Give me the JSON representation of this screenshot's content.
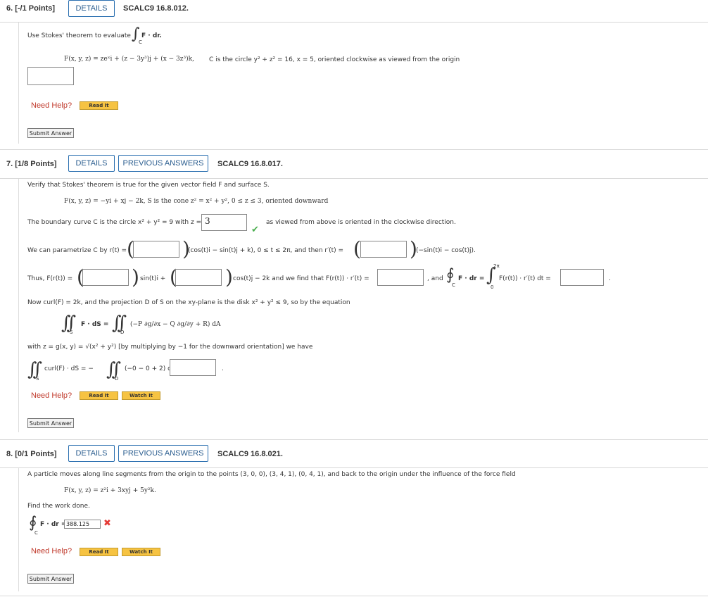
{
  "q6": {
    "number": "6. [-/1 Points]",
    "details": "DETAILS",
    "code": "SCALC9 16.8.012.",
    "intro": "Use Stokes' theorem to evaluate",
    "integrand": "F · dr.",
    "sub": "C",
    "field": "F(x, y, z) = zeˣi + (z − 3y³)j + (x − 3z³)k,",
    "curve": "C is the circle y² + z² = 16, x = 5, oriented clockwise as viewed from the origin",
    "need_help": "Need Help?",
    "read_it": "Read It",
    "submit": "Submit Answer"
  },
  "q7": {
    "number": "7. [1/8 Points]",
    "details": "DETAILS",
    "previous": "PREVIOUS ANSWERS",
    "code": "SCALC9 16.8.017.",
    "intro": "Verify that Stokes' theorem is true for the given vector field F and surface S.",
    "field": "F(x, y, z) = −yi + xj − 2k,   S is the cone z² = x² + y², 0 ≤ z ≤ 3, oriented downward",
    "boundary_pre": "The boundary curve C is the circle x² + y² = 9 with z =",
    "boundary_val": "3",
    "boundary_post": "as viewed from above is oriented in the clockwise direction.",
    "param_pre": "We can parametrize C by r(t) =",
    "param_mid": "(cos(t)i − sin(t)j + k), 0 ≤ t ≤ 2π, and then r′(t) =",
    "param_post": "(−sin(t)i − cos(t)j).",
    "thus_pre": "Thus, F(r(t)) =",
    "thus_mid1": "sin(t)i +",
    "thus_mid2": "cos(t)j − 2k and we find that F(r(t)) · r′(t) =",
    "thus_and": ", and",
    "thus_int": "F · dr =",
    "thus_int2": "F(r(t)) · r′(t) dt =",
    "upper": "2π",
    "lower": "0",
    "sub_c": "C",
    "curl_text": "Now curl(F) = 2k, and the projection D of S on the xy-plane is the disk x² + y² ≤ 9, so by the equation",
    "surf_int": "F · dS =",
    "surf_rhs": "(−P ∂g/∂x − Q ∂g/∂y + R) dA",
    "sub_s": "S",
    "sub_d": "D",
    "with_text": "with z = g(x, y) = √(x² + y²)  [by multiplying by −1 for the downward orientation] we have",
    "final_lhs": "curl(F) · dS = −",
    "final_rhs": "(−0 − 0 + 2) dA =",
    "period": ".",
    "need_help": "Need Help?",
    "read_it": "Read It",
    "watch_it": "Watch It",
    "submit": "Submit Answer"
  },
  "q8": {
    "number": "8. [0/1 Points]",
    "details": "DETAILS",
    "previous": "PREVIOUS ANSWERS",
    "code": "SCALC9 16.8.021.",
    "intro": "A particle moves along line segments from the origin to the points (3, 0, 0), (3, 4, 1), (0, 4, 1), and back to the origin under the influence of the force field",
    "field": "F(x, y, z) = z²i + 3xyj + 5y²k.",
    "find": "Find the work done.",
    "work_lhs": "F · dr =",
    "sub_c": "C",
    "answer": "388.125",
    "need_help": "Need Help?",
    "read_it": "Read It",
    "watch_it": "Watch It",
    "submit": "Submit Answer"
  }
}
